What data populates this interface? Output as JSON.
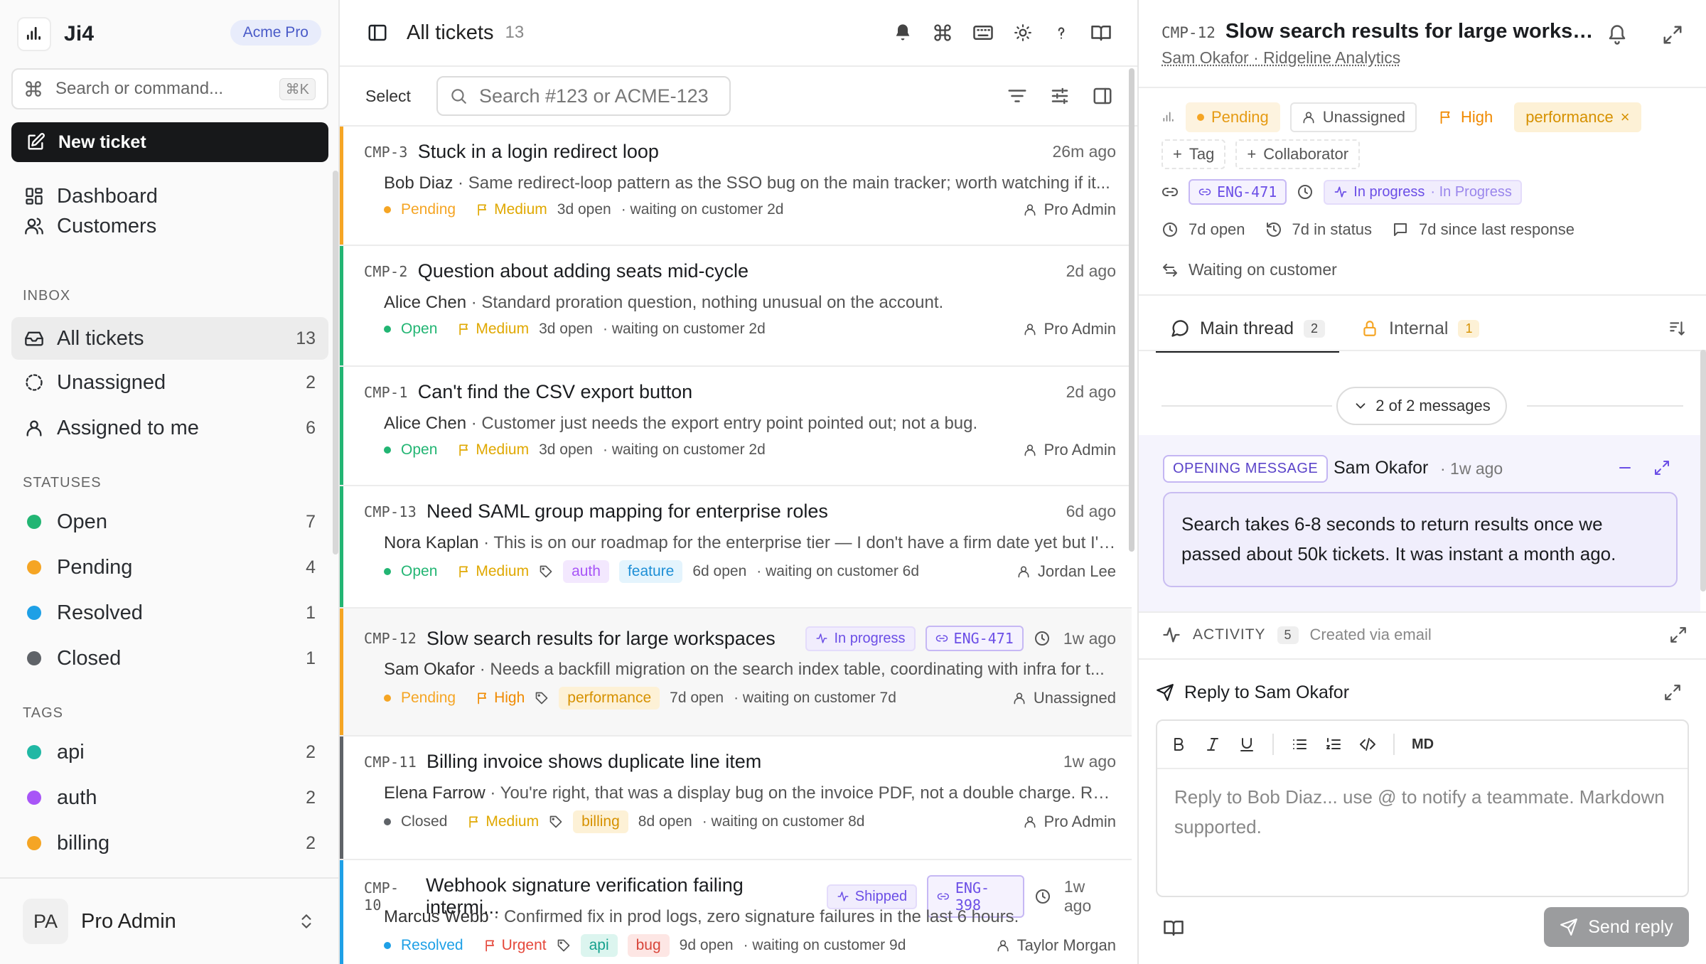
{
  "brand": {
    "name": "Ji4",
    "plan": "Acme Pro"
  },
  "sidebar": {
    "search_placeholder": "Search or command...",
    "search_shortcut": "⌘K",
    "new_ticket": "New ticket",
    "main_nav": [
      {
        "label": "Dashboard",
        "icon": "dashboard-icon"
      },
      {
        "label": "Customers",
        "icon": "users-icon"
      }
    ],
    "inbox_label": "INBOX",
    "inbox": [
      {
        "label": "All tickets",
        "count": "13"
      },
      {
        "label": "Unassigned",
        "count": "2"
      },
      {
        "label": "Assigned to me",
        "count": "6"
      }
    ],
    "statuses_label": "STATUSES",
    "statuses": [
      {
        "label": "Open",
        "count": "7",
        "color": "#22b573"
      },
      {
        "label": "Pending",
        "count": "4",
        "color": "#f5a524"
      },
      {
        "label": "Resolved",
        "count": "1",
        "color": "#1ea0e6"
      },
      {
        "label": "Closed",
        "count": "1",
        "color": "#5f6368"
      }
    ],
    "tags_label": "TAGS",
    "tags": [
      {
        "label": "api",
        "count": "2",
        "color": "#20b8a4"
      },
      {
        "label": "auth",
        "count": "2",
        "color": "#a855f7"
      },
      {
        "label": "billing",
        "count": "2",
        "color": "#f5a524"
      }
    ],
    "user": {
      "initials": "PA",
      "name": "Pro Admin"
    }
  },
  "list": {
    "title": "All tickets",
    "count": "13",
    "select_label": "Select",
    "search_placeholder": "Search #123 or ACME-123",
    "tickets": [
      {
        "id": "CMP-3",
        "title": "Stuck in a login redirect loop",
        "time": "26m ago",
        "author": "Bob Diaz",
        "snippet": "Same redirect-loop pattern as the SSO bug on the main tracker; worth watching if it...",
        "status": "Pending",
        "priority": "Medium",
        "tags": [],
        "age": "3d open",
        "waiting": "waiting on customer 2d",
        "assignee": "Pro Admin"
      },
      {
        "id": "CMP-2",
        "title": "Question about adding seats mid-cycle",
        "time": "2d ago",
        "author": "Alice Chen",
        "snippet": "Standard proration question, nothing unusual on the account.",
        "status": "Open",
        "priority": "Medium",
        "tags": [],
        "age": "3d open",
        "waiting": "waiting on customer 2d",
        "assignee": "Pro Admin"
      },
      {
        "id": "CMP-1",
        "title": "Can't find the CSV export button",
        "time": "2d ago",
        "author": "Alice Chen",
        "snippet": "Customer just needs the export entry point pointed out; not a bug.",
        "status": "Open",
        "priority": "Medium",
        "tags": [],
        "age": "3d open",
        "waiting": "waiting on customer 2d",
        "assignee": "Pro Admin"
      },
      {
        "id": "CMP-13",
        "title": "Need SAML group mapping for enterprise roles",
        "time": "6d ago",
        "author": "Nora Kaplan",
        "snippet": "This is on our roadmap for the enterprise tier — I don't have a firm date yet but I'll...",
        "status": "Open",
        "priority": "Medium",
        "tags": [
          "auth",
          "feature"
        ],
        "age": "6d open",
        "waiting": "waiting on customer 6d",
        "assignee": "Jordan Lee"
      },
      {
        "id": "CMP-12",
        "title": "Slow search results for large workspaces",
        "time": "1w ago",
        "author": "Sam Okafor",
        "snippet": "Needs a backfill migration on the search index table, coordinating with infra for t...",
        "status": "Pending",
        "priority": "High",
        "tags": [
          "performance"
        ],
        "age": "7d open",
        "waiting": "waiting on customer 7d",
        "assignee": "Unassigned",
        "progress": "In progress",
        "link": "ENG-471"
      },
      {
        "id": "CMP-11",
        "title": "Billing invoice shows duplicate line item",
        "time": "1w ago",
        "author": "Elena Farrow",
        "snippet": "You're right, that was a display bug on the invoice PDF, not a double charge. Reg...",
        "status": "Closed",
        "priority": "Medium",
        "tags": [
          "billing"
        ],
        "age": "8d open",
        "waiting": "waiting on customer 8d",
        "assignee": "Pro Admin"
      },
      {
        "id": "CMP-10",
        "title": "Webhook signature verification failing intermi...",
        "time": "1w ago",
        "author": "Marcus Webb",
        "snippet": "Confirmed fix in prod logs, zero signature failures in the last 6 hours.",
        "status": "Resolved",
        "priority": "Urgent",
        "tags": [
          "api",
          "bug"
        ],
        "age": "9d open",
        "waiting": "waiting on customer 9d",
        "assignee": "Taylor Morgan",
        "progress": "Shipped",
        "link": "ENG-398"
      }
    ]
  },
  "detail": {
    "id": "CMP-12",
    "title": "Slow search results for large workspa...",
    "requester": "Sam Okafor · Ridgeline Analytics",
    "status": "Pending",
    "assignee": "Unassigned",
    "priority": "High",
    "tag": "performance",
    "add_tag": "Tag",
    "add_collaborator": "Collaborator",
    "link": "ENG-471",
    "link_state": "In progress",
    "link_state_sub": "· In Progress",
    "open_age": "7d open",
    "in_status": "7d in status",
    "since_response": "7d since last response",
    "waiting": "Waiting on customer",
    "tabs": [
      {
        "label": "Main thread",
        "count": "2"
      },
      {
        "label": "Internal",
        "count": "1"
      }
    ],
    "messages_toggle": "2 of 2 messages",
    "opening_badge": "OPENING MESSAGE",
    "opening_author": "Sam Okafor",
    "opening_time": "· 1w ago",
    "opening_body": "Search takes 6-8 seconds to return results once we passed about 50k tickets. It was instant a month ago.",
    "activity_label": "ACTIVITY",
    "activity_count": "5",
    "activity_note": "Created via email",
    "reply_to": "Reply to Sam Okafor",
    "toolbar_md": "MD",
    "reply_placeholder": "Reply to Bob Diaz... use @ to notify a teammate. Markdown supported.",
    "send_label": "Send reply"
  },
  "colors": {
    "open": "#22b573",
    "pending": "#f5a524",
    "resolved": "#1ea0e6",
    "closed": "#5f6368",
    "medium": "#e0a800",
    "high": "#f08a00",
    "urgent": "#e5483b",
    "accent": "#6b4ee6"
  }
}
